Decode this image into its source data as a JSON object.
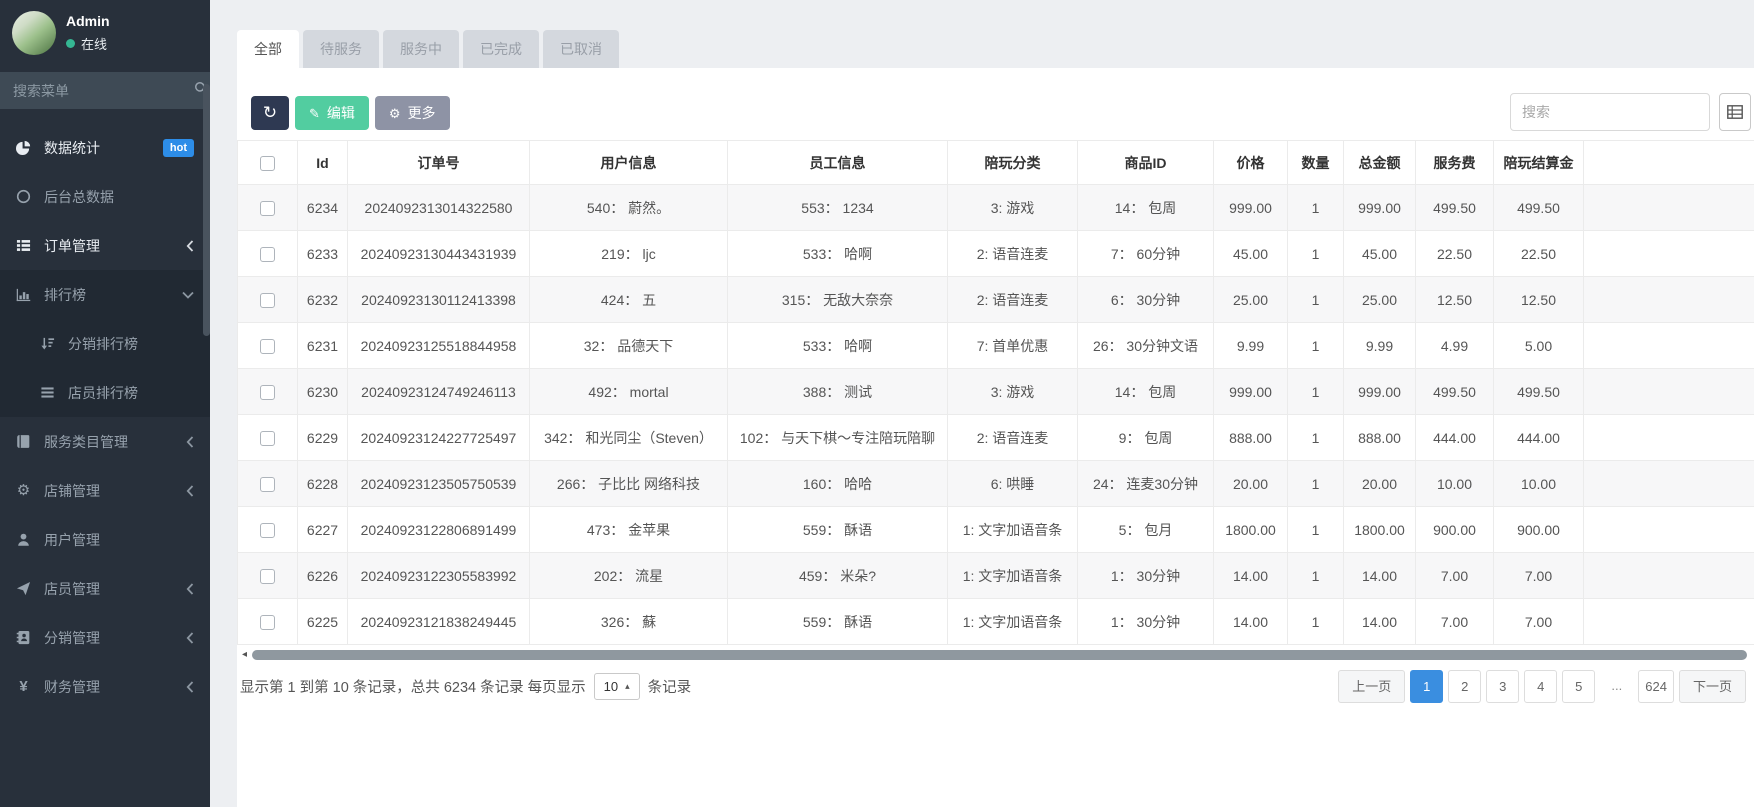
{
  "sidebar": {
    "user": {
      "name": "Admin",
      "status": "在线"
    },
    "search_placeholder": "搜索菜单",
    "items": [
      {
        "label": "数据统计",
        "badge": "hot",
        "icon": "pie-chart"
      },
      {
        "label": "后台总数据",
        "icon": "circle-o"
      },
      {
        "label": "订单管理",
        "icon": "th-list",
        "arrow": "left"
      },
      {
        "label": "排行榜",
        "icon": "bar-chart",
        "arrow": "down"
      },
      {
        "label": "分销排行榜",
        "icon": "sort-amount"
      },
      {
        "label": "店员排行榜",
        "icon": "list-lines"
      },
      {
        "label": "服务类目管理",
        "icon": "book",
        "arrow": "left"
      },
      {
        "label": "店铺管理",
        "icon": "cogs",
        "arrow": "left"
      },
      {
        "label": "用户管理",
        "icon": "user"
      },
      {
        "label": "店员管理",
        "icon": "paper-plane",
        "arrow": "left"
      },
      {
        "label": "分销管理",
        "icon": "address-book",
        "arrow": "left"
      },
      {
        "label": "财务管理",
        "icon": "yen",
        "arrow": "left"
      }
    ]
  },
  "tabs": [
    {
      "label": "全部",
      "active": true
    },
    {
      "label": "待服务",
      "active": false
    },
    {
      "label": "服务中",
      "active": false
    },
    {
      "label": "已完成",
      "active": false
    },
    {
      "label": "已取消",
      "active": false
    }
  ],
  "toolbar": {
    "edit_label": "编辑",
    "more_label": "更多",
    "search_placeholder": "搜索"
  },
  "icons": {
    "refresh": "↻",
    "pencil": "✎",
    "gear": "⚙",
    "caret_up": "▴",
    "scroll_left": "◂"
  },
  "table": {
    "headers": [
      "Id",
      "订单号",
      "用户信息",
      "员工信息",
      "陪玩分类",
      "商品ID",
      "价格",
      "数量",
      "总金额",
      "服务费",
      "陪玩结算金"
    ],
    "rows": [
      {
        "id": "6234",
        "order_no": "2024092313014322580",
        "user": "540： 蔚然。",
        "staff": "553： 1234",
        "category": "3: 游戏",
        "product": "14： 包周",
        "price": "999.00",
        "qty": "1",
        "total": "999.00",
        "fee": "499.50",
        "settle": "499.50"
      },
      {
        "id": "6233",
        "order_no": "20240923130443431939",
        "user": "219： ljc",
        "staff": "533： 哈啊",
        "category": "2: 语音连麦",
        "product": "7： 60分钟",
        "price": "45.00",
        "qty": "1",
        "total": "45.00",
        "fee": "22.50",
        "settle": "22.50"
      },
      {
        "id": "6232",
        "order_no": "20240923130112413398",
        "user": "424： 五",
        "staff": "315： 无敌大奈奈",
        "category": "2: 语音连麦",
        "product": "6： 30分钟",
        "price": "25.00",
        "qty": "1",
        "total": "25.00",
        "fee": "12.50",
        "settle": "12.50"
      },
      {
        "id": "6231",
        "order_no": "20240923125518844958",
        "user": "32： 品德天下",
        "staff": "533： 哈啊",
        "category": "7: 首单优惠",
        "product": "26： 30分钟文语",
        "price": "9.99",
        "qty": "1",
        "total": "9.99",
        "fee": "4.99",
        "settle": "5.00"
      },
      {
        "id": "6230",
        "order_no": "20240923124749246113",
        "user": "492： mortal",
        "staff": "388： 测试",
        "category": "3: 游戏",
        "product": "14： 包周",
        "price": "999.00",
        "qty": "1",
        "total": "999.00",
        "fee": "499.50",
        "settle": "499.50"
      },
      {
        "id": "6229",
        "order_no": "20240923124227725497",
        "user": "342： 和光同尘（Steven）",
        "staff": "102： 与天下棋～专注陪玩陪聊",
        "category": "2: 语音连麦",
        "product": "9： 包周",
        "price": "888.00",
        "qty": "1",
        "total": "888.00",
        "fee": "444.00",
        "settle": "444.00"
      },
      {
        "id": "6228",
        "order_no": "20240923123505750539",
        "user": "266： 子比比 网络科技",
        "staff": "160： 哈哈",
        "category": "6: 哄睡",
        "product": "24： 连麦30分钟",
        "price": "20.00",
        "qty": "1",
        "total": "20.00",
        "fee": "10.00",
        "settle": "10.00"
      },
      {
        "id": "6227",
        "order_no": "20240923122806891499",
        "user": "473： 金苹果",
        "staff": "559： 酥语",
        "category": "1: 文字加语音条",
        "product": "5： 包月",
        "price": "1800.00",
        "qty": "1",
        "total": "1800.00",
        "fee": "900.00",
        "settle": "900.00"
      },
      {
        "id": "6226",
        "order_no": "20240923122305583992",
        "user": "202： 流星",
        "staff": "459： 米朵?",
        "category": "1: 文字加语音条",
        "product": "1： 30分钟",
        "price": "14.00",
        "qty": "1",
        "total": "14.00",
        "fee": "7.00",
        "settle": "7.00"
      },
      {
        "id": "6225",
        "order_no": "20240923121838249445",
        "user": "326： 蘇",
        "staff": "559： 酥语",
        "category": "1: 文字加语音条",
        "product": "1： 30分钟",
        "price": "14.00",
        "qty": "1",
        "total": "14.00",
        "fee": "7.00",
        "settle": "7.00"
      }
    ]
  },
  "footer": {
    "summary_prefix": "显示第 1 到第 10 条记录，总共 6234 条记录 每页显示",
    "page_size": "10",
    "summary_suffix": "条记录",
    "pagination": {
      "prev": "上一页",
      "pages": [
        "1",
        "2",
        "3",
        "4",
        "5",
        "...",
        "624"
      ],
      "active_page": "1",
      "next": "下一页"
    }
  },
  "colors": {
    "sidebar_bg": "#28303b",
    "accent_blue": "#2d8de8",
    "pagination_active_blue": "#3a8ee0",
    "edit_green": "#52cda0",
    "refresh_navy": "#2e3952",
    "more_grey": "#8e93a5",
    "online_green": "#35b793"
  }
}
